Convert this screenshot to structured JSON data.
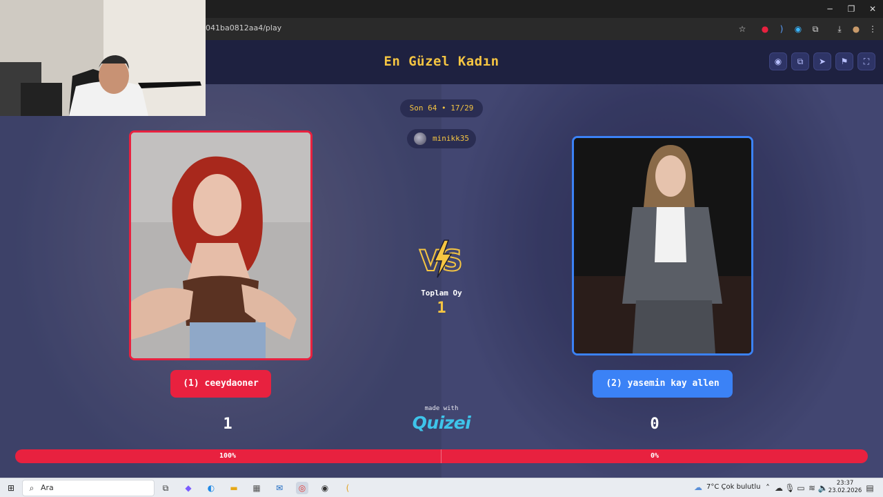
{
  "browser": {
    "url": "041ba0812aa4/play",
    "window_controls": {
      "minimize": "─",
      "restore": "❐",
      "close": "✕"
    },
    "icons": [
      "star-icon",
      "extension-icon",
      "extension-icon",
      "extension-icon",
      "puzzle-icon",
      "download-icon",
      "profile-icon",
      "menu-icon"
    ]
  },
  "header": {
    "title": "En Güzel Kadın",
    "buttons": [
      "eye-icon",
      "copy-icon",
      "send-icon",
      "flag-icon",
      "fullscreen-icon"
    ]
  },
  "round": {
    "label": "Son 64 • 17/29"
  },
  "voter": {
    "name": "minikk35"
  },
  "left": {
    "name": "(1) ceeydaoner",
    "score": "1",
    "percent_label": "100%",
    "percent": 100,
    "color": "#e8213f"
  },
  "right": {
    "name": "(2) yasemin kay allen",
    "score": "0",
    "percent_label": "0%",
    "percent": 0,
    "color": "#3b82f6"
  },
  "center": {
    "total_label": "Toplam Oy",
    "total_value": "1",
    "made_with": "made with",
    "brand": "Quizei"
  },
  "taskbar": {
    "search_text": "Ara",
    "weather": "7°C  Çok bulutlu",
    "time": "23:37",
    "date": "23.02.2026"
  }
}
